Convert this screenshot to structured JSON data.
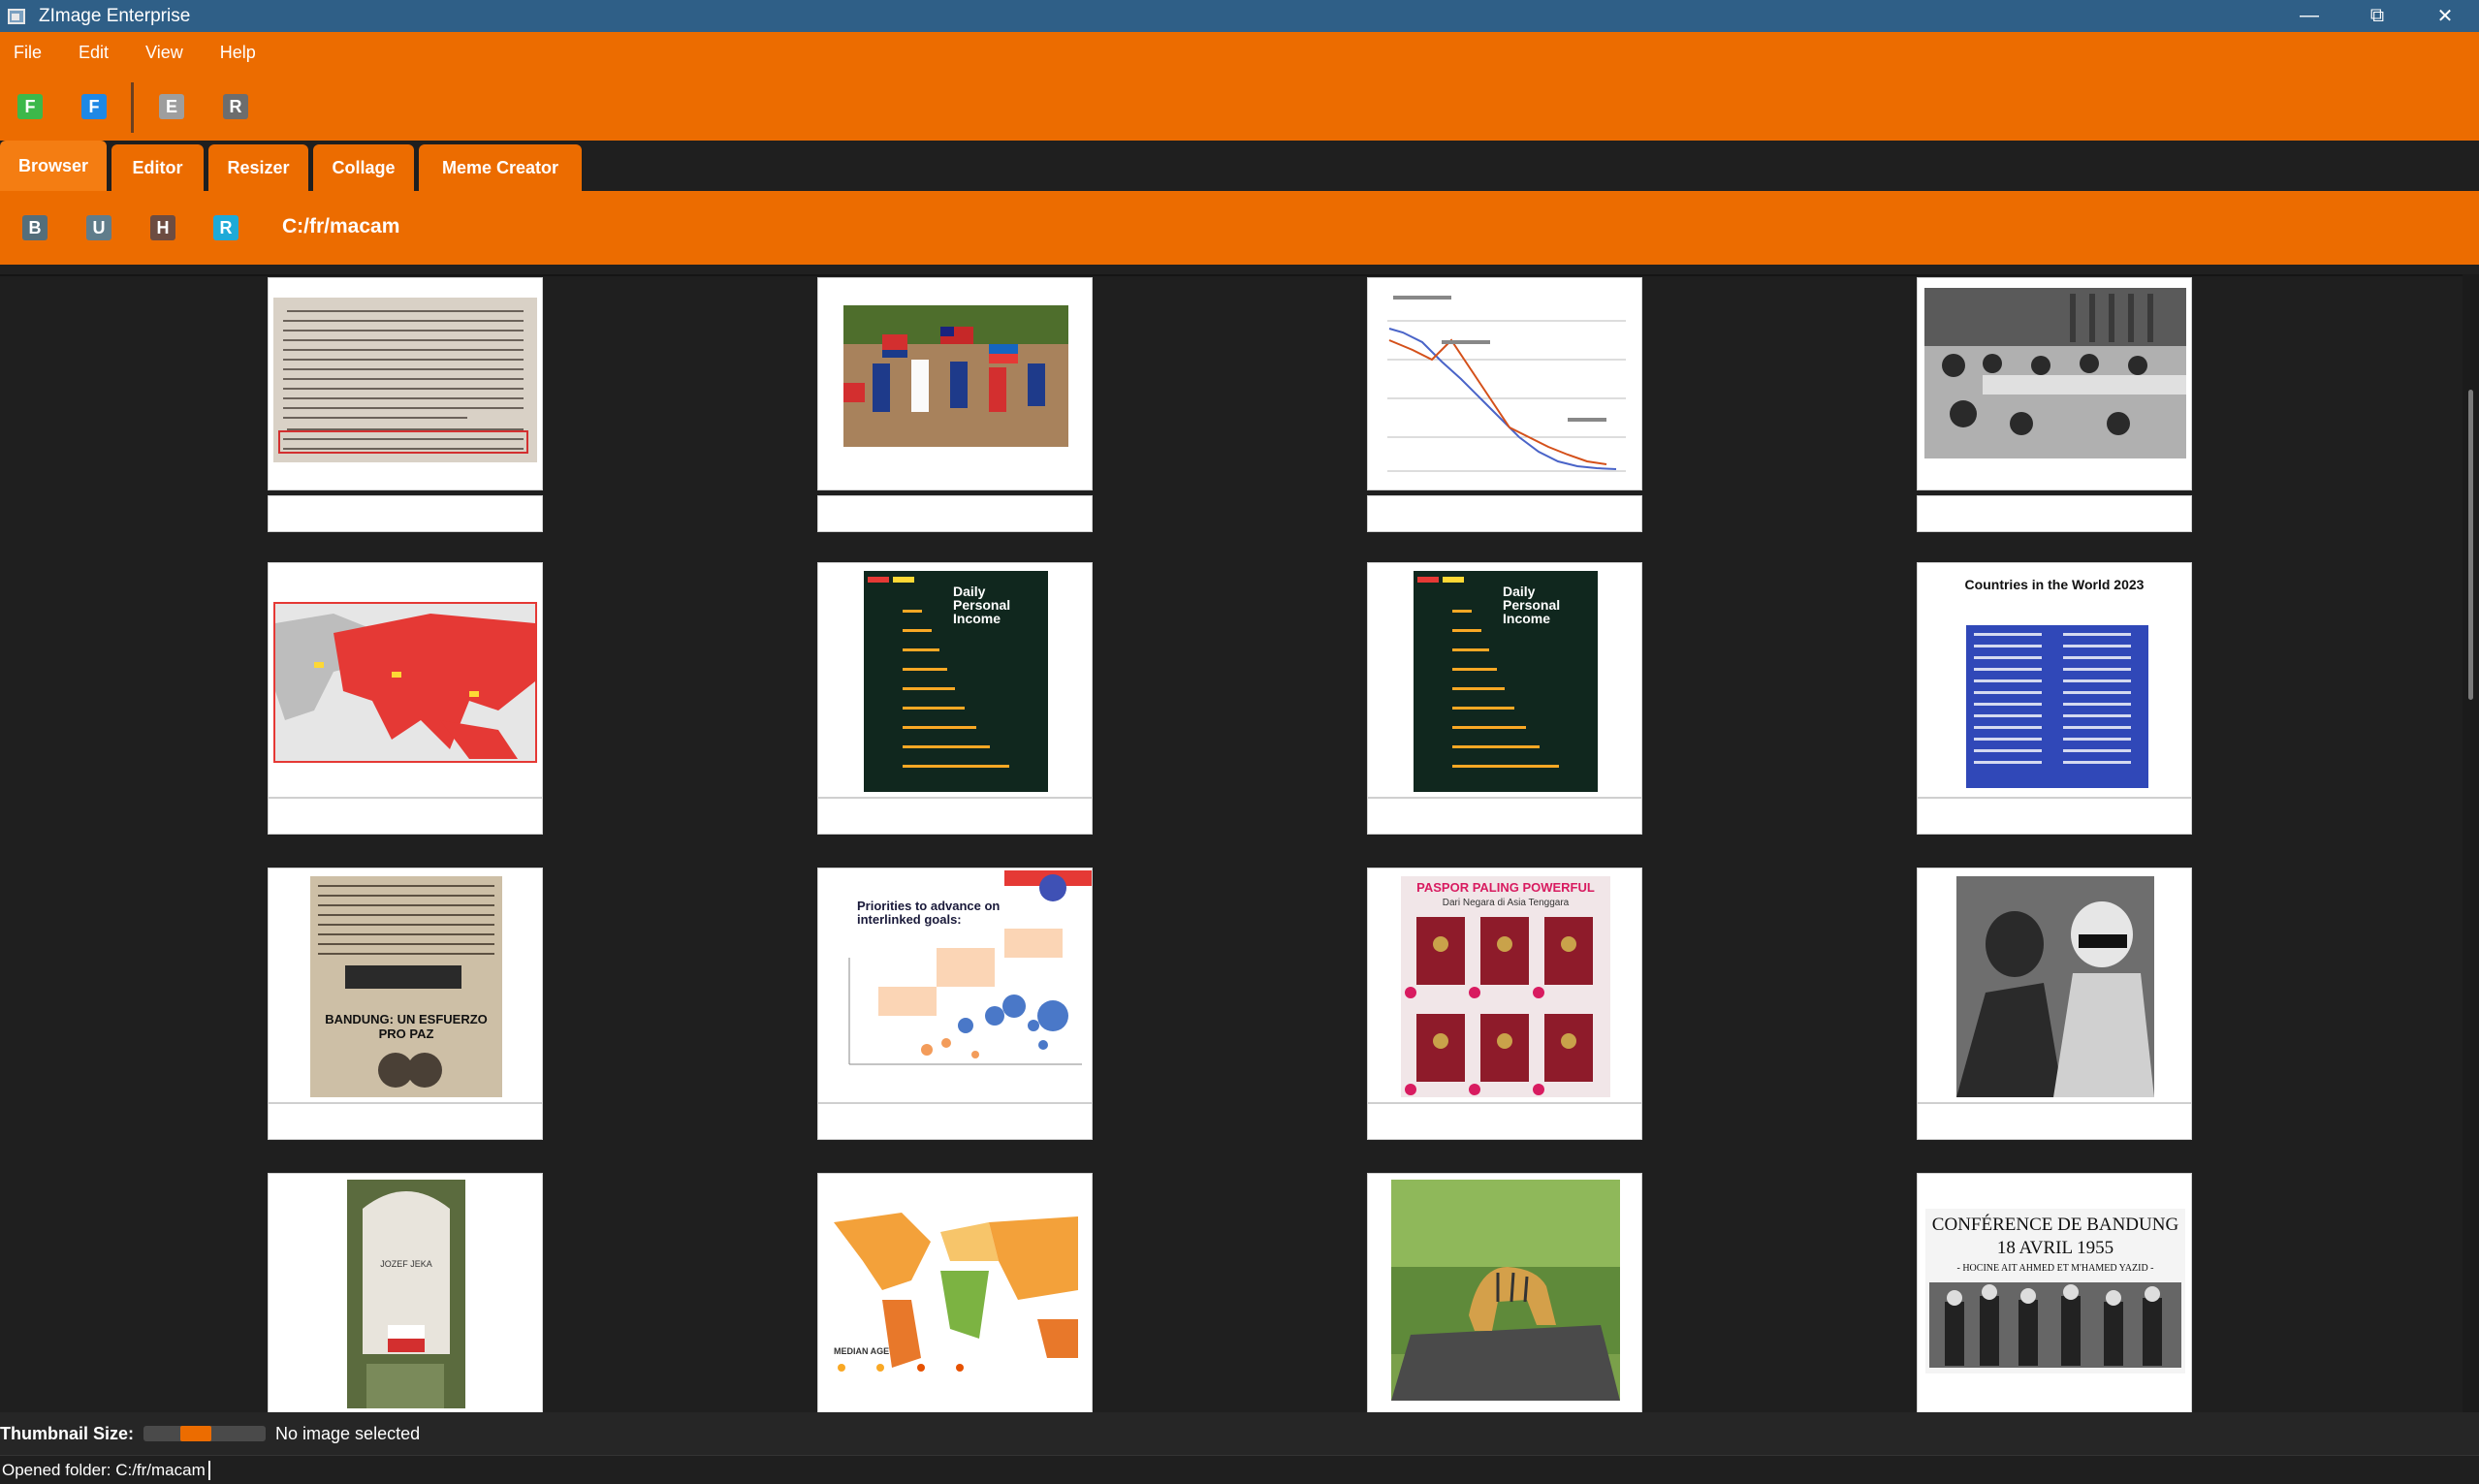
{
  "window": {
    "title": "ZImage Enterprise",
    "minimize_icon": "minimize-icon",
    "restore_icon": "restore-icon",
    "close_icon": "close-icon"
  },
  "menu": [
    "File",
    "Edit",
    "View",
    "Help"
  ],
  "toolbar": {
    "buttons": [
      {
        "label": "F",
        "color": "#3cb84a"
      },
      {
        "label": "F",
        "color": "#1e88e5"
      },
      {
        "label": "E",
        "color": "#9e9e9e"
      },
      {
        "label": "R",
        "color": "#6d6d6d"
      }
    ]
  },
  "tabs": [
    "Browser",
    "Editor",
    "Resizer",
    "Collage",
    "Meme Creator"
  ],
  "active_tab": "Browser",
  "pathbar": {
    "buttons": [
      {
        "label": "B",
        "color": "#546e7a"
      },
      {
        "label": "U",
        "color": "#607d8b"
      },
      {
        "label": "H",
        "color": "#6d4c41"
      },
      {
        "label": "R",
        "color": "#1eaad8"
      }
    ],
    "path": "C:/fr/macam"
  },
  "thumbnails": [
    {
      "kind": "document-scan",
      "text": ""
    },
    {
      "kind": "children-flags-photo",
      "text": ""
    },
    {
      "kind": "line-chart",
      "text": ""
    },
    {
      "kind": "bw-conference-photo",
      "text": ""
    },
    {
      "kind": "asia-map",
      "text": ""
    },
    {
      "kind": "infographic",
      "title": "Daily Personal Income"
    },
    {
      "kind": "infographic",
      "title": "Daily Personal Income"
    },
    {
      "kind": "infographic-list",
      "title": "Countries in the World 2023"
    },
    {
      "kind": "newspaper",
      "headline": "BANDUNG: UN ESFUERZO PRO PAZ"
    },
    {
      "kind": "bubble-chart",
      "title": "Priorities to advance on interlinked goals:"
    },
    {
      "kind": "passport-infographic",
      "title": "PASPOR PALING POWERFUL",
      "subtitle": "Dari Negara di Asia Tenggara"
    },
    {
      "kind": "bw-portrait-photo",
      "text": ""
    },
    {
      "kind": "gravestone-photo",
      "text": "JOZEF JEKA"
    },
    {
      "kind": "world-map",
      "text": "MEDIAN AGE"
    },
    {
      "kind": "tiger-statue-photo",
      "text": ""
    },
    {
      "kind": "poster",
      "title": "CONFÉRENCE DE BANDUNG",
      "subtitle": "18 AVRIL 1955",
      "caption": "- HOCINE AIT AHMED ET M'HAMED YAZID -"
    }
  ],
  "status": {
    "thumbnail_size_label": "Thumbnail Size:",
    "slider_value": 0.4,
    "selection": "No image selected"
  },
  "footer": {
    "message": "Opened folder: C:/fr/macam"
  }
}
